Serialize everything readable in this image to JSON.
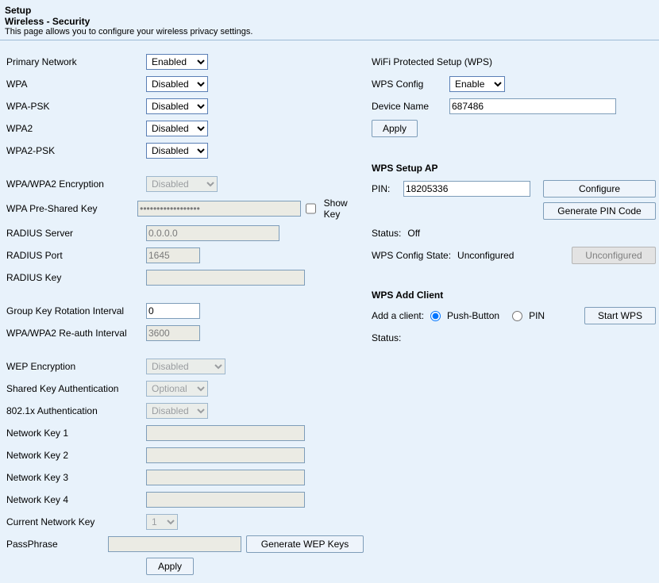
{
  "header": {
    "title": "Setup",
    "subtitle": "Wireless - Security",
    "desc": "This page allows you to configure your wireless privacy settings."
  },
  "left": {
    "primary_network_label": "Primary Network",
    "primary_network_value": "Enabled",
    "wpa_label": "WPA",
    "wpa_value": "Disabled",
    "wpa_psk_label": "WPA-PSK",
    "wpa_psk_value": "Disabled",
    "wpa2_label": "WPA2",
    "wpa2_value": "Disabled",
    "wpa2_psk_label": "WPA2-PSK",
    "wpa2_psk_value": "Disabled",
    "wpa_enc_label": "WPA/WPA2 Encryption",
    "wpa_enc_value": "Disabled",
    "wpa_psk_key_label": "WPA Pre-Shared Key",
    "wpa_psk_key_value": "••••••••••••••••••",
    "show_key_label": "Show Key",
    "radius_server_label": "RADIUS Server",
    "radius_server_value": "0.0.0.0",
    "radius_port_label": "RADIUS Port",
    "radius_port_value": "1645",
    "radius_key_label": "RADIUS Key",
    "radius_key_value": "",
    "grp_key_label": "Group Key Rotation Interval",
    "grp_key_value": "0",
    "reauth_label": "WPA/WPA2 Re-auth Interval",
    "reauth_value": "3600",
    "wep_enc_label": "WEP Encryption",
    "wep_enc_value": "Disabled",
    "shared_key_auth_label": "Shared Key Authentication",
    "shared_key_auth_value": "Optional",
    "dot1x_label": "802.1x Authentication",
    "dot1x_value": "Disabled",
    "nk1_label": "Network Key 1",
    "nk2_label": "Network Key 2",
    "nk3_label": "Network Key 3",
    "nk4_label": "Network Key 4",
    "nk_value": "",
    "current_nk_label": "Current Network Key",
    "current_nk_value": "1",
    "passphrase_label": "PassPhrase",
    "passphrase_value": "",
    "gen_wep_label": "Generate WEP Keys",
    "apply_label": "Apply"
  },
  "right": {
    "wps_title": "WiFi Protected Setup (WPS)",
    "wps_config_label": "WPS Config",
    "wps_config_value": "Enable",
    "device_name_label": "Device Name",
    "device_name_value": "687486",
    "apply_label": "Apply",
    "setup_ap_title": "WPS Setup AP",
    "pin_label": "PIN:",
    "pin_value": "18205336",
    "configure_label": "Configure",
    "gen_pin_label": "Generate PIN Code",
    "status_label": "Status:",
    "status_value": "Off",
    "cfg_state_label": "WPS Config State:",
    "cfg_state_value": "Unconfigured",
    "unconfigured_btn": "Unconfigured",
    "add_client_title": "WPS Add Client",
    "add_client_label": "Add a client:",
    "pb_label": "Push-Button",
    "pin_radio_label": "PIN",
    "start_wps_label": "Start WPS",
    "status2_label": "Status:"
  }
}
